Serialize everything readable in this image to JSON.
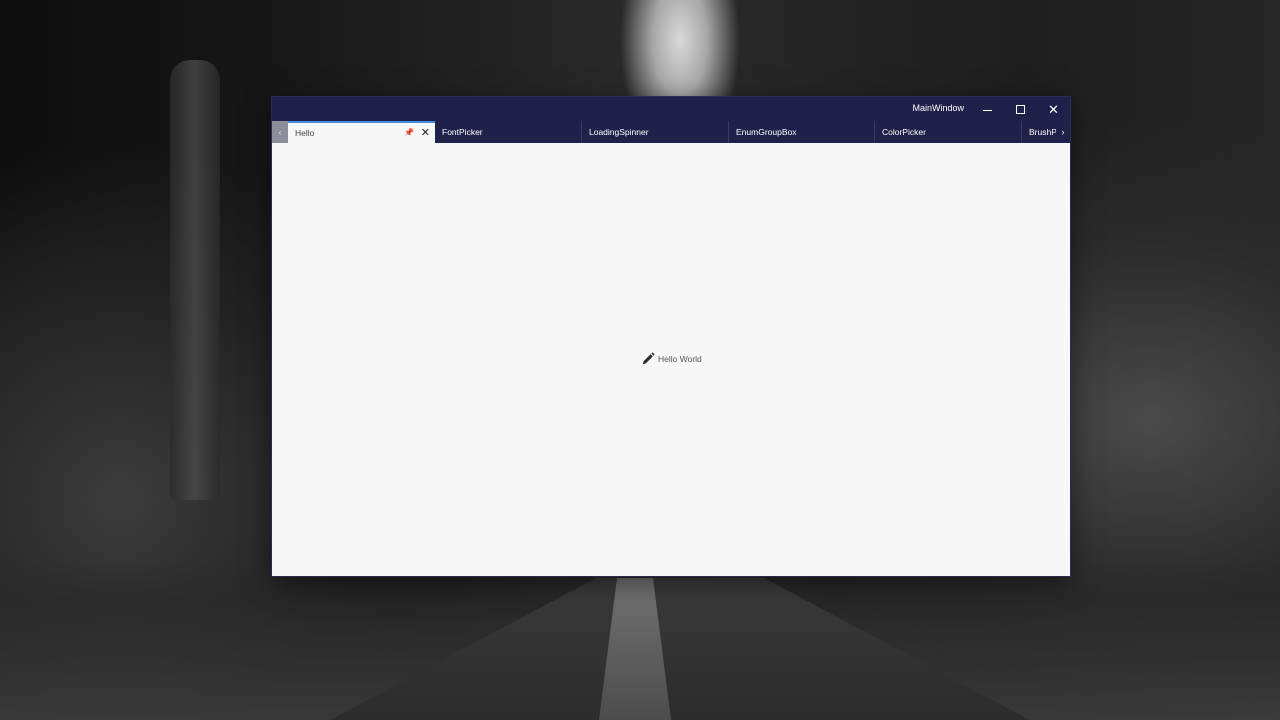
{
  "window": {
    "title": "MainWindow",
    "caption_buttons": {
      "minimize": "minimize-icon",
      "maximize": "maximize-icon",
      "close": "close-icon"
    }
  },
  "tabs": [
    {
      "label": "Hello",
      "active": true
    },
    {
      "label": "FontPicker",
      "active": false
    },
    {
      "label": "LoadingSpinner",
      "active": false
    },
    {
      "label": "EnumGroupBox",
      "active": false
    },
    {
      "label": "ColorPicker",
      "active": false
    },
    {
      "label": "BrushPi",
      "active": false
    }
  ],
  "tab_scroll": {
    "left": "‹",
    "right": "›"
  },
  "active_tab_icons": {
    "pin": "pin-icon",
    "close": "close-icon"
  },
  "content": {
    "icon": "pencil-icon",
    "text": "Hello World"
  },
  "colors": {
    "titlebar": "#20214a",
    "content_bg": "#f7f7f7",
    "active_tab_accent": "#3a8ee6"
  }
}
